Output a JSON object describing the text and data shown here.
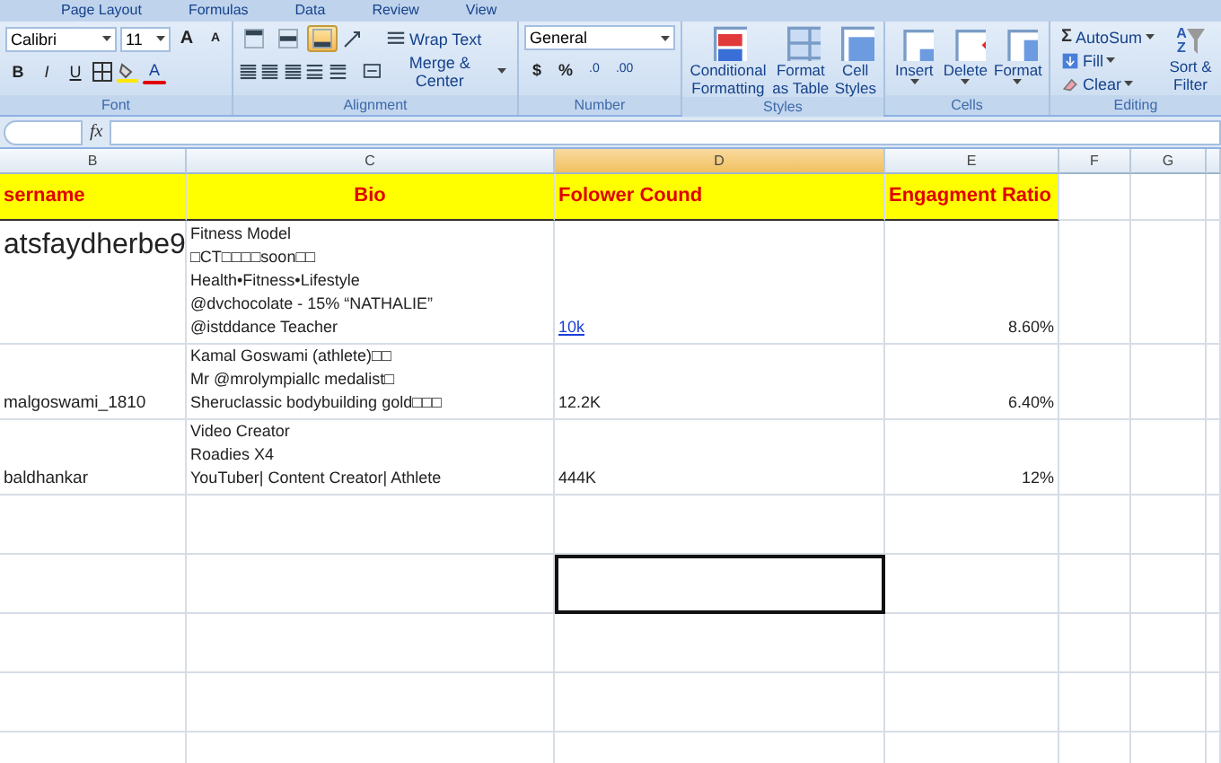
{
  "ribbon_tabs": [
    "Page Layout",
    "Formulas",
    "Data",
    "Review",
    "View"
  ],
  "font_group": {
    "label": "Font",
    "family": "Calibri",
    "size": "11",
    "grow": "A",
    "shrink": "A",
    "style_buttons": [
      "B",
      "I",
      "U"
    ],
    "color_button": "A"
  },
  "alignment_group": {
    "label": "Alignment",
    "vertical": [
      {
        "selected": false
      },
      {
        "selected": false
      },
      {
        "selected": true
      }
    ],
    "wrap_text": "Wrap Text",
    "merge_center": "Merge & Center"
  },
  "number_group": {
    "label": "Number",
    "format": "General",
    "buttons": [
      "$",
      "%"
    ],
    "decimal_buttons": [
      ".0",
      ".00"
    ]
  },
  "styles_group": {
    "label": "Styles",
    "buttons": [
      "Conditional Formatting",
      "Format as Table",
      "Cell Styles"
    ]
  },
  "cells_group": {
    "label": "Cells",
    "buttons": [
      "Insert",
      "Delete",
      "Format"
    ]
  },
  "editing_group": {
    "label": "Editing",
    "sigma": "Σ",
    "buttons": [
      "AutoSum",
      "Fill",
      "Clear"
    ],
    "sort_letters": [
      "A",
      "Z"
    ],
    "sort": "Sort & Filter"
  },
  "formula_bar": {
    "label": "fx"
  },
  "columns": [
    {
      "letter": "B",
      "selected": false
    },
    {
      "letter": "C",
      "selected": false
    },
    {
      "letter": "D",
      "selected": true
    },
    {
      "letter": "E",
      "selected": false
    },
    {
      "letter": "F",
      "selected": false
    },
    {
      "letter": "G",
      "selected": false
    }
  ],
  "header": [
    "sername",
    "Bio",
    "Folower Cound",
    "Engagment Ratio"
  ],
  "rows": [
    {
      "username": "atsfaydherbe9",
      "large": true,
      "bio": [
        "Fitness Model",
        "□CT□□□□soon□□",
        "Health•Fitness•Lifestyle",
        "@dvchocolate - 15% “NATHALIE”",
        "@istddance Teacher"
      ],
      "followers": "10k",
      "link": true,
      "ratio": "8.60%"
    },
    {
      "username": "malgoswami_1810",
      "large": false,
      "bio": [
        "Kamal Goswami (athlete)□□",
        "Mr @mrolympiallc medalist□",
        "Sheruclassic bodybuilding gold□□□"
      ],
      "followers": "12.2K",
      "link": false,
      "ratio": "6.40%"
    },
    {
      "username": "baldhankar",
      "large": false,
      "bio": [
        "Video Creator",
        "Roadies X4",
        "YouTuber| Content Creator| Athlete"
      ],
      "followers": "444K",
      "link": false,
      "ratio": "12%"
    }
  ],
  "empty_rows": [
    {
      "active": false
    },
    {
      "active": true
    },
    {
      "active": false
    },
    {
      "active": false
    },
    {
      "active": false
    }
  ]
}
